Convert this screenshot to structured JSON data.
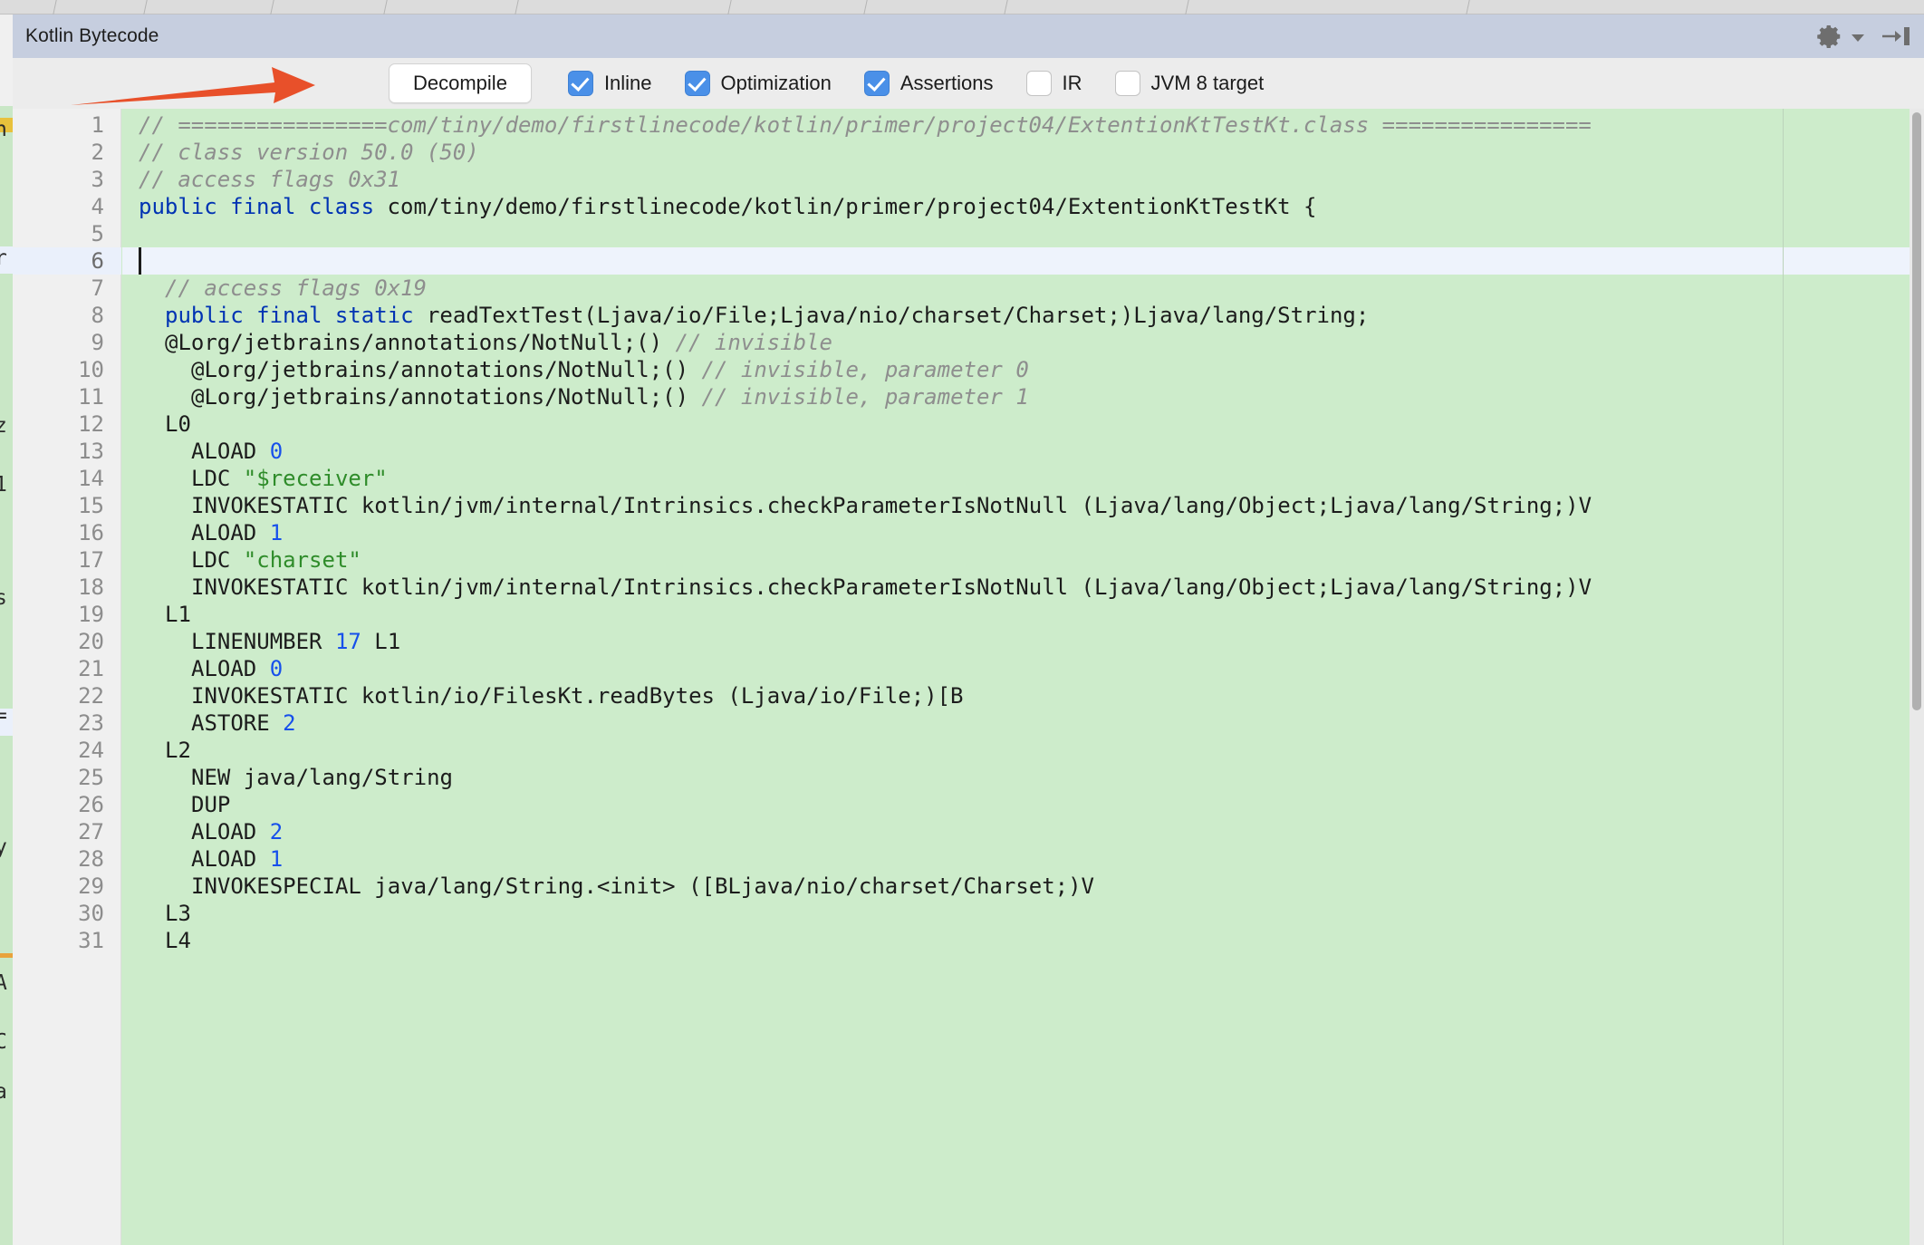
{
  "window": {
    "title": "Kotlin Bytecode",
    "settings_icon": "gear-icon",
    "settings_chevron": "chevron-down-icon",
    "hide_icon": "hide-to-right-icon"
  },
  "toolbar": {
    "decompile_label": "Decompile",
    "checkboxes": [
      {
        "label": "Inline",
        "checked": true
      },
      {
        "label": "Optimization",
        "checked": true
      },
      {
        "label": "Assertions",
        "checked": true
      },
      {
        "label": "IR",
        "checked": false
      },
      {
        "label": "JVM 8 target",
        "checked": false
      }
    ]
  },
  "annotation": {
    "shape": "red-arrow-pointing-right",
    "color": "#e8502a"
  },
  "colors": {
    "title_bar": "#c6cedf",
    "toolbar_bg": "#ececec",
    "editor_bg": "#cdeccb",
    "caret_line": "#eef3fc",
    "gutter_bg": "#f0f0f0",
    "checkbox_accent": "#4a90e8",
    "keyword": "#0033b3",
    "number": "#1750eb",
    "string": "#2f8c2a",
    "comment": "#8e8e8e",
    "arrow": "#e8502a"
  },
  "editor": {
    "caret_line_number": 6,
    "first_line": 1,
    "last_line": 31,
    "lines": [
      {
        "n": 1,
        "indent": 0,
        "tokens": [
          {
            "t": "cm",
            "v": "// ================com/tiny/demo/firstlinecode/kotlin/primer/project04/ExtentionKtTestKt.class ================"
          }
        ]
      },
      {
        "n": 2,
        "indent": 0,
        "tokens": [
          {
            "t": "cm",
            "v": "// class version 50.0 (50)"
          }
        ]
      },
      {
        "n": 3,
        "indent": 0,
        "tokens": [
          {
            "t": "cm",
            "v": "// access flags 0x31"
          }
        ]
      },
      {
        "n": 4,
        "indent": 0,
        "tokens": [
          {
            "t": "kw",
            "v": "public final class "
          },
          {
            "t": "pl",
            "v": "com/tiny/demo/firstlinecode/kotlin/primer/project04/ExtentionKtTestKt {"
          }
        ]
      },
      {
        "n": 5,
        "indent": 0,
        "tokens": []
      },
      {
        "n": 6,
        "indent": 0,
        "tokens": []
      },
      {
        "n": 7,
        "indent": 1,
        "tokens": [
          {
            "t": "cm",
            "v": "// access flags 0x19"
          }
        ]
      },
      {
        "n": 8,
        "indent": 1,
        "tokens": [
          {
            "t": "kw",
            "v": "public final static "
          },
          {
            "t": "pl",
            "v": "readTextTest(Ljava/io/File;Ljava/nio/charset/Charset;)Ljava/lang/String;"
          }
        ]
      },
      {
        "n": 9,
        "indent": 1,
        "tokens": [
          {
            "t": "pl",
            "v": "@Lorg/jetbrains/annotations/NotNull;() "
          },
          {
            "t": "cm",
            "v": "// invisible"
          }
        ]
      },
      {
        "n": 10,
        "indent": 2,
        "tokens": [
          {
            "t": "pl",
            "v": "@Lorg/jetbrains/annotations/NotNull;() "
          },
          {
            "t": "cm",
            "v": "// invisible, parameter 0"
          }
        ]
      },
      {
        "n": 11,
        "indent": 2,
        "tokens": [
          {
            "t": "pl",
            "v": "@Lorg/jetbrains/annotations/NotNull;() "
          },
          {
            "t": "cm",
            "v": "// invisible, parameter 1"
          }
        ]
      },
      {
        "n": 12,
        "indent": 1,
        "tokens": [
          {
            "t": "pl",
            "v": "L0"
          }
        ]
      },
      {
        "n": 13,
        "indent": 2,
        "tokens": [
          {
            "t": "pl",
            "v": "ALOAD "
          },
          {
            "t": "num",
            "v": "0"
          }
        ]
      },
      {
        "n": 14,
        "indent": 2,
        "tokens": [
          {
            "t": "pl",
            "v": "LDC "
          },
          {
            "t": "str",
            "v": "\"$receiver\""
          }
        ]
      },
      {
        "n": 15,
        "indent": 2,
        "tokens": [
          {
            "t": "pl",
            "v": "INVOKESTATIC kotlin/jvm/internal/Intrinsics.checkParameterIsNotNull (Ljava/lang/Object;Ljava/lang/String;)V"
          }
        ]
      },
      {
        "n": 16,
        "indent": 2,
        "tokens": [
          {
            "t": "pl",
            "v": "ALOAD "
          },
          {
            "t": "num",
            "v": "1"
          }
        ]
      },
      {
        "n": 17,
        "indent": 2,
        "tokens": [
          {
            "t": "pl",
            "v": "LDC "
          },
          {
            "t": "str",
            "v": "\"charset\""
          }
        ]
      },
      {
        "n": 18,
        "indent": 2,
        "tokens": [
          {
            "t": "pl",
            "v": "INVOKESTATIC kotlin/jvm/internal/Intrinsics.checkParameterIsNotNull (Ljava/lang/Object;Ljava/lang/String;)V"
          }
        ]
      },
      {
        "n": 19,
        "indent": 1,
        "tokens": [
          {
            "t": "pl",
            "v": "L1"
          }
        ]
      },
      {
        "n": 20,
        "indent": 2,
        "tokens": [
          {
            "t": "pl",
            "v": "LINENUMBER "
          },
          {
            "t": "num",
            "v": "17"
          },
          {
            "t": "pl",
            "v": " L1"
          }
        ]
      },
      {
        "n": 21,
        "indent": 2,
        "tokens": [
          {
            "t": "pl",
            "v": "ALOAD "
          },
          {
            "t": "num",
            "v": "0"
          }
        ]
      },
      {
        "n": 22,
        "indent": 2,
        "tokens": [
          {
            "t": "pl",
            "v": "INVOKESTATIC kotlin/io/FilesKt.readBytes (Ljava/io/File;)[B"
          }
        ]
      },
      {
        "n": 23,
        "indent": 2,
        "tokens": [
          {
            "t": "pl",
            "v": "ASTORE "
          },
          {
            "t": "num",
            "v": "2"
          }
        ]
      },
      {
        "n": 24,
        "indent": 1,
        "tokens": [
          {
            "t": "pl",
            "v": "L2"
          }
        ]
      },
      {
        "n": 25,
        "indent": 2,
        "tokens": [
          {
            "t": "pl",
            "v": "NEW java/lang/String"
          }
        ]
      },
      {
        "n": 26,
        "indent": 2,
        "tokens": [
          {
            "t": "pl",
            "v": "DUP"
          }
        ]
      },
      {
        "n": 27,
        "indent": 2,
        "tokens": [
          {
            "t": "pl",
            "v": "ALOAD "
          },
          {
            "t": "num",
            "v": "2"
          }
        ]
      },
      {
        "n": 28,
        "indent": 2,
        "tokens": [
          {
            "t": "pl",
            "v": "ALOAD "
          },
          {
            "t": "num",
            "v": "1"
          }
        ]
      },
      {
        "n": 29,
        "indent": 2,
        "tokens": [
          {
            "t": "pl",
            "v": "INVOKESPECIAL java/lang/String.<init> ([BLjava/nio/charset/Charset;)V"
          }
        ]
      },
      {
        "n": 30,
        "indent": 1,
        "tokens": [
          {
            "t": "pl",
            "v": "L3"
          }
        ]
      },
      {
        "n": 31,
        "indent": 1,
        "tokens": [
          {
            "t": "pl",
            "v": "L4"
          }
        ]
      }
    ]
  },
  "background_editor": {
    "fragments": [
      "n",
      "r",
      "z",
      "1",
      "s",
      "=",
      "y",
      "A",
      "C",
      "a"
    ]
  }
}
